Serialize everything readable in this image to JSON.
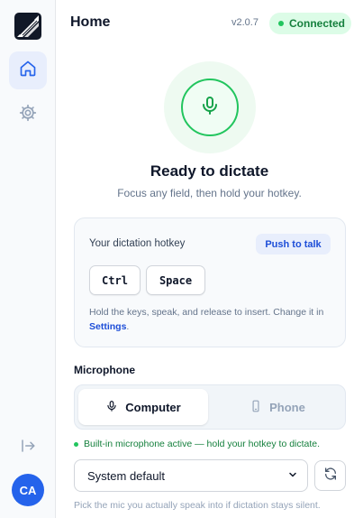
{
  "app": {
    "accent": "#2563eb",
    "success": "#22c55e"
  },
  "sidebar": {
    "items": [
      {
        "name": "home",
        "icon": "home-icon",
        "active": true
      },
      {
        "name": "settings",
        "icon": "gear-icon",
        "active": false
      }
    ],
    "logout_icon": "logout-icon",
    "avatar_initials": "CA"
  },
  "header": {
    "title": "Home",
    "version": "v2.0.7",
    "status": "Connected"
  },
  "hero": {
    "icon": "microphone-icon",
    "title": "Ready to dictate",
    "subtitle": "Focus any field, then hold your hotkey."
  },
  "hotkey": {
    "label": "Your dictation hotkey",
    "mode": "Push to talk",
    "keys": [
      "Ctrl",
      "Space"
    ],
    "help_prefix": "Hold the keys, speak, and release to insert. Change it in ",
    "help_link": "Settings",
    "help_suffix": "."
  },
  "microphone": {
    "section_label": "Microphone",
    "sources": [
      {
        "label": "Computer",
        "icon": "microphone-icon",
        "selected": true
      },
      {
        "label": "Phone",
        "icon": "phone-icon",
        "selected": false
      }
    ],
    "status": "Built-in microphone active — hold your hotkey to dictate.",
    "device": "System default",
    "hint": "Pick the mic you actually speak into if dictation stays silent."
  }
}
